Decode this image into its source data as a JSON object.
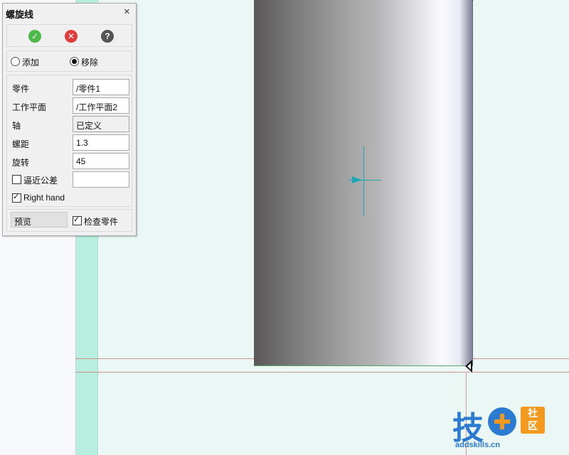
{
  "dialog": {
    "title": "螺旋线",
    "close_glyph": "×",
    "actions": {
      "ok_icon": "check-circle",
      "cancel_icon": "x-circle",
      "help_icon": "question-circle",
      "ok_glyph": "✓",
      "cancel_glyph": "✕",
      "help_glyph": "?"
    },
    "mode": {
      "add_label": "添加",
      "remove_label": "移除",
      "selected": "移除"
    },
    "fields": {
      "part_label": "零件",
      "part_value": "/零件1",
      "plane_label": "工作平面",
      "plane_value": "/工作平面2",
      "axis_label": "轴",
      "axis_value": "已定义",
      "pitch_label": "螺距",
      "pitch_value": "1.3",
      "rotation_label": "旋转",
      "rotation_value": "45",
      "tolerance_label": "逼近公差",
      "tolerance_checked": false,
      "tolerance_value": "",
      "right_hand_label": "Right hand",
      "right_hand_checked": true
    },
    "bottom": {
      "preview_label": "预览",
      "check_part_label": "检查零件",
      "check_part_checked": true
    }
  },
  "viewport": {
    "colors": {
      "background": "#eaf7f5",
      "band": "#b8eee0",
      "datum_lines": "#e0393a",
      "crosshair": "#1ba8b6"
    }
  },
  "watermark": {
    "main_char": "技",
    "box_top": "社",
    "box_bottom": "区",
    "url": "addskills.cn"
  }
}
